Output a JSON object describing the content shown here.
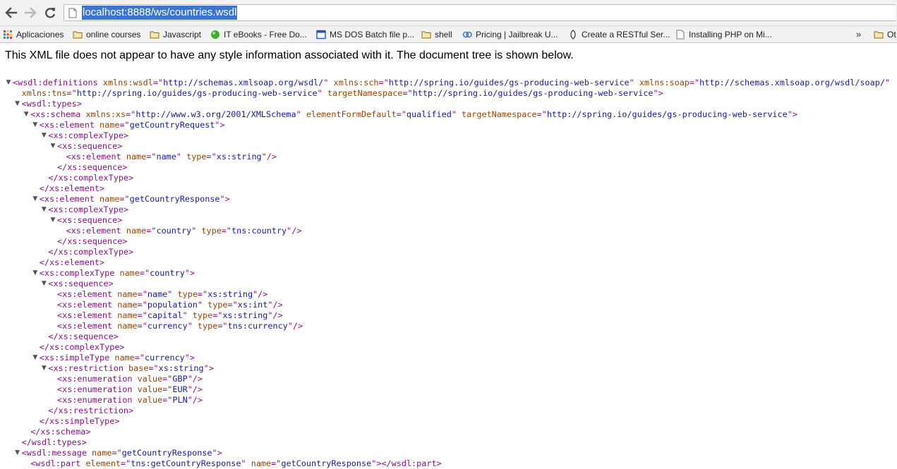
{
  "toolbar": {
    "url": "localhost:8888/ws/countries.wsdl",
    "back_icon": "arrow-left-icon",
    "forward_icon": "arrow-right-icon",
    "reload_icon": "reload-icon"
  },
  "bookmarks": [
    {
      "label": "Aplicaciones",
      "icon": "apps-grid-icon"
    },
    {
      "label": "online courses",
      "icon": "folder-icon"
    },
    {
      "label": "Javascript",
      "icon": "folder-icon"
    },
    {
      "label": "IT eBooks - Free Do...",
      "icon": "green-ball-icon"
    },
    {
      "label": "MS DOS Batch file p...",
      "icon": "window-icon"
    },
    {
      "label": "shell",
      "icon": "folder-icon"
    },
    {
      "label": "Pricing | Jailbreak U...",
      "icon": "link-icon"
    },
    {
      "label": "Create a RESTful Ser...",
      "icon": "leaf-icon"
    },
    {
      "label": "Installing PHP on Mi...",
      "icon": "page-icon"
    },
    {
      "label": "Ot",
      "icon": "folder-icon"
    }
  ],
  "bookmarks_more": "»",
  "notice": "This XML file does not appear to have any style information associated with it. The document tree is shown below.",
  "tree": [
    {
      "t": "▼",
      "i": 0,
      "s": [
        [
          "tg",
          "<wsdl:definitions"
        ],
        [
          "an",
          " xmlns:wsdl"
        ],
        [
          "tg",
          "=\""
        ],
        [
          "av",
          "http://schemas.xmlsoap.org/wsdl/"
        ],
        [
          "tg",
          "\""
        ],
        [
          "an",
          " xmlns:sch"
        ],
        [
          "tg",
          "=\""
        ],
        [
          "av",
          "http://spring.io/guides/gs-producing-web-service"
        ],
        [
          "tg",
          "\""
        ],
        [
          "an",
          " xmlns:soap"
        ],
        [
          "tg",
          "=\""
        ],
        [
          "av",
          "http://schemas.xmlsoap.org/wsdl/soap/"
        ],
        [
          "tg",
          "\""
        ]
      ]
    },
    {
      "t": "",
      "i": 1,
      "s": [
        [
          "an",
          "xmlns:tns"
        ],
        [
          "tg",
          "=\""
        ],
        [
          "av",
          "http://spring.io/guides/gs-producing-web-service"
        ],
        [
          "tg",
          "\""
        ],
        [
          "an",
          " targetNamespace"
        ],
        [
          "tg",
          "=\""
        ],
        [
          "av",
          "http://spring.io/guides/gs-producing-web-service"
        ],
        [
          "tg",
          "\">"
        ]
      ]
    },
    {
      "t": "▼",
      "i": 1,
      "s": [
        [
          "tg",
          "<wsdl:types>"
        ]
      ]
    },
    {
      "t": "▼",
      "i": 2,
      "s": [
        [
          "tg",
          "<xs:schema"
        ],
        [
          "an",
          " xmlns:xs"
        ],
        [
          "tg",
          "=\""
        ],
        [
          "av",
          "http://www.w3.org/2001/XMLSchema"
        ],
        [
          "tg",
          "\""
        ],
        [
          "an",
          " elementFormDefault"
        ],
        [
          "tg",
          "=\""
        ],
        [
          "av",
          "qualified"
        ],
        [
          "tg",
          "\""
        ],
        [
          "an",
          " targetNamespace"
        ],
        [
          "tg",
          "=\""
        ],
        [
          "av",
          "http://spring.io/guides/gs-producing-web-service"
        ],
        [
          "tg",
          "\">"
        ]
      ]
    },
    {
      "t": "▼",
      "i": 3,
      "s": [
        [
          "tg",
          "<xs:element"
        ],
        [
          "an",
          " name"
        ],
        [
          "tg",
          "=\""
        ],
        [
          "av",
          "getCountryRequest"
        ],
        [
          "tg",
          "\">"
        ]
      ]
    },
    {
      "t": "▼",
      "i": 4,
      "s": [
        [
          "tg",
          "<xs:complexType>"
        ]
      ]
    },
    {
      "t": "▼",
      "i": 5,
      "s": [
        [
          "tg",
          "<xs:sequence>"
        ]
      ]
    },
    {
      "t": "",
      "i": 6,
      "s": [
        [
          "tg",
          "<xs:element"
        ],
        [
          "an",
          " name"
        ],
        [
          "tg",
          "=\""
        ],
        [
          "av",
          "name"
        ],
        [
          "tg",
          "\""
        ],
        [
          "an",
          " type"
        ],
        [
          "tg",
          "=\""
        ],
        [
          "av",
          "xs:string"
        ],
        [
          "tg",
          "\"/>"
        ]
      ]
    },
    {
      "t": "",
      "i": 5,
      "s": [
        [
          "tg",
          "</xs:sequence>"
        ]
      ]
    },
    {
      "t": "",
      "i": 4,
      "s": [
        [
          "tg",
          "</xs:complexType>"
        ]
      ]
    },
    {
      "t": "",
      "i": 3,
      "s": [
        [
          "tg",
          "</xs:element>"
        ]
      ]
    },
    {
      "t": "▼",
      "i": 3,
      "s": [
        [
          "tg",
          "<xs:element"
        ],
        [
          "an",
          " name"
        ],
        [
          "tg",
          "=\""
        ],
        [
          "av",
          "getCountryResponse"
        ],
        [
          "tg",
          "\">"
        ]
      ]
    },
    {
      "t": "▼",
      "i": 4,
      "s": [
        [
          "tg",
          "<xs:complexType>"
        ]
      ]
    },
    {
      "t": "▼",
      "i": 5,
      "s": [
        [
          "tg",
          "<xs:sequence>"
        ]
      ]
    },
    {
      "t": "",
      "i": 6,
      "s": [
        [
          "tg",
          "<xs:element"
        ],
        [
          "an",
          " name"
        ],
        [
          "tg",
          "=\""
        ],
        [
          "av",
          "country"
        ],
        [
          "tg",
          "\""
        ],
        [
          "an",
          " type"
        ],
        [
          "tg",
          "=\""
        ],
        [
          "av",
          "tns:country"
        ],
        [
          "tg",
          "\"/>"
        ]
      ]
    },
    {
      "t": "",
      "i": 5,
      "s": [
        [
          "tg",
          "</xs:sequence>"
        ]
      ]
    },
    {
      "t": "",
      "i": 4,
      "s": [
        [
          "tg",
          "</xs:complexType>"
        ]
      ]
    },
    {
      "t": "",
      "i": 3,
      "s": [
        [
          "tg",
          "</xs:element>"
        ]
      ]
    },
    {
      "t": "▼",
      "i": 3,
      "s": [
        [
          "tg",
          "<xs:complexType"
        ],
        [
          "an",
          " name"
        ],
        [
          "tg",
          "=\""
        ],
        [
          "av",
          "country"
        ],
        [
          "tg",
          "\">"
        ]
      ]
    },
    {
      "t": "▼",
      "i": 4,
      "s": [
        [
          "tg",
          "<xs:sequence>"
        ]
      ]
    },
    {
      "t": "",
      "i": 5,
      "s": [
        [
          "tg",
          "<xs:element"
        ],
        [
          "an",
          " name"
        ],
        [
          "tg",
          "=\""
        ],
        [
          "av",
          "name"
        ],
        [
          "tg",
          "\""
        ],
        [
          "an",
          " type"
        ],
        [
          "tg",
          "=\""
        ],
        [
          "av",
          "xs:string"
        ],
        [
          "tg",
          "\"/>"
        ]
      ]
    },
    {
      "t": "",
      "i": 5,
      "s": [
        [
          "tg",
          "<xs:element"
        ],
        [
          "an",
          " name"
        ],
        [
          "tg",
          "=\""
        ],
        [
          "av",
          "population"
        ],
        [
          "tg",
          "\""
        ],
        [
          "an",
          " type"
        ],
        [
          "tg",
          "=\""
        ],
        [
          "av",
          "xs:int"
        ],
        [
          "tg",
          "\"/>"
        ]
      ]
    },
    {
      "t": "",
      "i": 5,
      "s": [
        [
          "tg",
          "<xs:element"
        ],
        [
          "an",
          " name"
        ],
        [
          "tg",
          "=\""
        ],
        [
          "av",
          "capital"
        ],
        [
          "tg",
          "\""
        ],
        [
          "an",
          " type"
        ],
        [
          "tg",
          "=\""
        ],
        [
          "av",
          "xs:string"
        ],
        [
          "tg",
          "\"/>"
        ]
      ]
    },
    {
      "t": "",
      "i": 5,
      "s": [
        [
          "tg",
          "<xs:element"
        ],
        [
          "an",
          " name"
        ],
        [
          "tg",
          "=\""
        ],
        [
          "av",
          "currency"
        ],
        [
          "tg",
          "\""
        ],
        [
          "an",
          " type"
        ],
        [
          "tg",
          "=\""
        ],
        [
          "av",
          "tns:currency"
        ],
        [
          "tg",
          "\"/>"
        ]
      ]
    },
    {
      "t": "",
      "i": 4,
      "s": [
        [
          "tg",
          "</xs:sequence>"
        ]
      ]
    },
    {
      "t": "",
      "i": 3,
      "s": [
        [
          "tg",
          "</xs:complexType>"
        ]
      ]
    },
    {
      "t": "▼",
      "i": 3,
      "s": [
        [
          "tg",
          "<xs:simpleType"
        ],
        [
          "an",
          " name"
        ],
        [
          "tg",
          "=\""
        ],
        [
          "av",
          "currency"
        ],
        [
          "tg",
          "\">"
        ]
      ]
    },
    {
      "t": "▼",
      "i": 4,
      "s": [
        [
          "tg",
          "<xs:restriction"
        ],
        [
          "an",
          " base"
        ],
        [
          "tg",
          "=\""
        ],
        [
          "av",
          "xs:string"
        ],
        [
          "tg",
          "\">"
        ]
      ]
    },
    {
      "t": "",
      "i": 5,
      "s": [
        [
          "tg",
          "<xs:enumeration"
        ],
        [
          "an",
          " value"
        ],
        [
          "tg",
          "=\""
        ],
        [
          "av",
          "GBP"
        ],
        [
          "tg",
          "\"/>"
        ]
      ]
    },
    {
      "t": "",
      "i": 5,
      "s": [
        [
          "tg",
          "<xs:enumeration"
        ],
        [
          "an",
          " value"
        ],
        [
          "tg",
          "=\""
        ],
        [
          "av",
          "EUR"
        ],
        [
          "tg",
          "\"/>"
        ]
      ]
    },
    {
      "t": "",
      "i": 5,
      "s": [
        [
          "tg",
          "<xs:enumeration"
        ],
        [
          "an",
          " value"
        ],
        [
          "tg",
          "=\""
        ],
        [
          "av",
          "PLN"
        ],
        [
          "tg",
          "\"/>"
        ]
      ]
    },
    {
      "t": "",
      "i": 4,
      "s": [
        [
          "tg",
          "</xs:restriction>"
        ]
      ]
    },
    {
      "t": "",
      "i": 3,
      "s": [
        [
          "tg",
          "</xs:simpleType>"
        ]
      ]
    },
    {
      "t": "",
      "i": 2,
      "s": [
        [
          "tg",
          "</xs:schema>"
        ]
      ]
    },
    {
      "t": "",
      "i": 1,
      "s": [
        [
          "tg",
          "</wsdl:types>"
        ]
      ]
    },
    {
      "t": "▼",
      "i": 1,
      "s": [
        [
          "tg",
          "<wsdl:message"
        ],
        [
          "an",
          " name"
        ],
        [
          "tg",
          "=\""
        ],
        [
          "av",
          "getCountryResponse"
        ],
        [
          "tg",
          "\">"
        ]
      ]
    },
    {
      "t": "",
      "i": 2,
      "s": [
        [
          "tg",
          "<wsdl:part"
        ],
        [
          "an",
          " element"
        ],
        [
          "tg",
          "=\""
        ],
        [
          "av",
          "tns:getCountryResponse"
        ],
        [
          "tg",
          "\""
        ],
        [
          "an",
          " name"
        ],
        [
          "tg",
          "=\""
        ],
        [
          "av",
          "getCountryResponse"
        ],
        [
          "tg",
          "\">"
        ],
        [
          "tg",
          "</wsdl:part>"
        ]
      ]
    }
  ]
}
